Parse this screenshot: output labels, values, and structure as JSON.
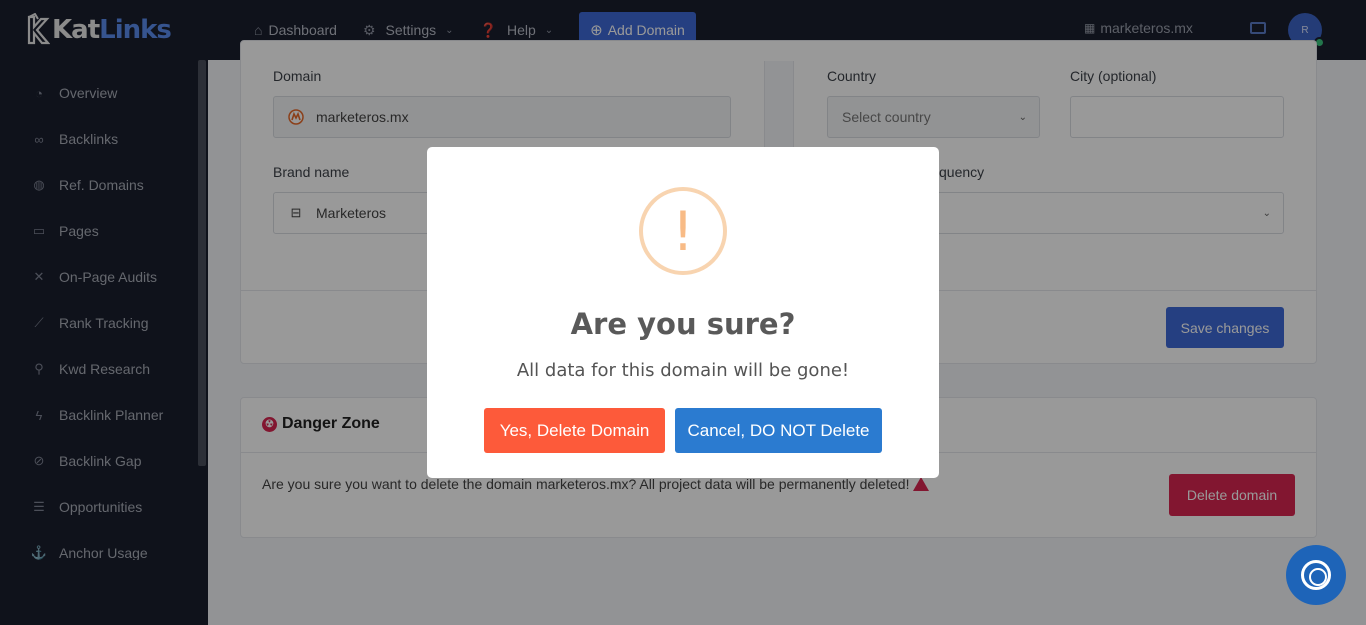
{
  "app": {
    "logo_prefix": "Kat",
    "logo_suffix": "Links"
  },
  "sidebar": {
    "items": [
      {
        "label": "Overview",
        "icon": "gauge-icon"
      },
      {
        "label": "Backlinks",
        "icon": "link-icon"
      },
      {
        "label": "Ref. Domains",
        "icon": "globe-icon"
      },
      {
        "label": "Pages",
        "icon": "window-icon"
      },
      {
        "label": "On-Page Audits",
        "icon": "tools-icon"
      },
      {
        "label": "Rank Tracking",
        "icon": "chart-line-icon"
      },
      {
        "label": "Kwd Research",
        "icon": "search-icon"
      },
      {
        "label": "Backlink Planner",
        "icon": "bolt-icon"
      },
      {
        "label": "Backlink Gap",
        "icon": "unlink-icon"
      },
      {
        "label": "Opportunities",
        "icon": "list-icon"
      },
      {
        "label": "Anchor Usage",
        "icon": "anchor-icon"
      }
    ]
  },
  "topbar": {
    "dashboard": "Dashboard",
    "settings": "Settings",
    "help": "Help",
    "add_domain": "Add Domain",
    "current_domain": "marketeros.mx",
    "avatar_initial": "R"
  },
  "form": {
    "domain_label": "Domain",
    "domain_value": "marketeros.mx",
    "brand_label": "Brand name",
    "brand_value": "Marketeros",
    "country_label": "Country",
    "country_placeholder": "Select country",
    "city_label": "City (optional)",
    "city_value": "",
    "frequency_label_partial": "quency",
    "save_button": "Save changes"
  },
  "danger_zone": {
    "title": "Danger Zone",
    "text": "Are you sure you want to delete the domain marketeros.mx? All project data will be permanently deleted!",
    "delete_button": "Delete domain"
  },
  "modal": {
    "icon_glyph": "!",
    "title": "Are you sure?",
    "text": "All data for this domain will be gone!",
    "confirm_button": "Yes, Delete Domain",
    "cancel_button": "Cancel, DO NOT Delete"
  },
  "colors": {
    "sidebar_bg": "#1a1f2e",
    "primary": "#3f6ad8",
    "danger": "#d92550",
    "modal_confirm": "#fd5a3a",
    "modal_cancel": "#2b7bd0",
    "warning_ring": "#f8d4b0"
  }
}
